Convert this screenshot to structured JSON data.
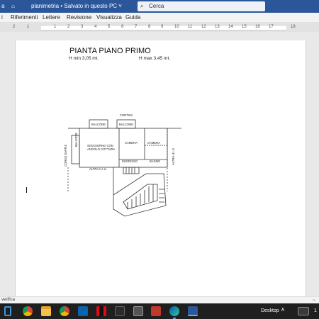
{
  "titlebar": {
    "left_mark": "a",
    "quick_access": "⌂",
    "doc_title": "planimetria • Salvato in questo PC ˅",
    "search_icon": "⌕",
    "search_text": "Cerca"
  },
  "ribbon": {
    "left_mark": "i",
    "tabs": [
      "Riferimenti",
      "Lettere",
      "Revisione",
      "Visualizza",
      "Guida"
    ]
  },
  "ruler": {
    "numbers": [
      "2",
      "1",
      "1",
      "2",
      "3",
      "4",
      "5",
      "6",
      "7",
      "8",
      "9",
      "10",
      "11",
      "12",
      "13",
      "14",
      "15",
      "16",
      "17",
      "18"
    ]
  },
  "document": {
    "plan_title": "PIANTA PIANO PRIMO",
    "h_min": "H min 3,05 mt.",
    "h_max": "H max 3,45 mt.",
    "labels": {
      "cortile": "CORTILE",
      "balcone1": "BALCONE",
      "balcone2": "BALCONE",
      "balcone_side": "BALCONE",
      "camera1": "CAMERA",
      "camera2": "CAMERA",
      "soggiorno1": "SOGGIORNO CON",
      "soggiorno2": "ANGOLO COTTURA",
      "ingresso": "INGRESSO",
      "bagno": "BAGNO",
      "corso": "CORSO SAFFIZ",
      "altra_left": "ALTRA U.I.U.",
      "altra_right": "ALTRA U.I.U."
    }
  },
  "statusbar": {
    "left": "verifica",
    "right": "↔"
  },
  "taskbar": {
    "icons": [
      "edge-legacy",
      "chrome",
      "file-explorer",
      "chrome",
      "outlook",
      "netflix",
      "dark-app",
      "calculator",
      "red-app",
      "edge",
      "settings",
      "word"
    ],
    "desktop_label": "Desktop",
    "tray_up": "∧",
    "clock": "1"
  }
}
